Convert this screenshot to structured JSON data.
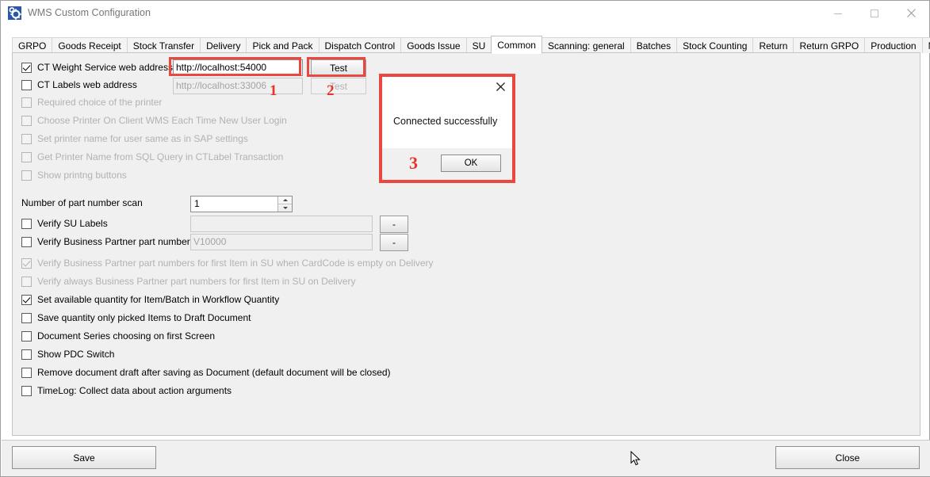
{
  "window": {
    "title": "WMS Custom Configuration",
    "icon": "gear-icon",
    "minimize_label": "–",
    "maximize_label": "□",
    "close_label": "✕"
  },
  "tabs": [
    {
      "label": "GRPO",
      "active": false
    },
    {
      "label": "Goods Receipt",
      "active": false
    },
    {
      "label": "Stock Transfer",
      "active": false
    },
    {
      "label": "Delivery",
      "active": false
    },
    {
      "label": "Pick and Pack",
      "active": false
    },
    {
      "label": "Dispatch Control",
      "active": false
    },
    {
      "label": "Goods Issue",
      "active": false
    },
    {
      "label": "SU",
      "active": false
    },
    {
      "label": "Common",
      "active": true
    },
    {
      "label": "Scanning: general",
      "active": false
    },
    {
      "label": "Batches",
      "active": false
    },
    {
      "label": "Stock Counting",
      "active": false
    },
    {
      "label": "Return",
      "active": false
    },
    {
      "label": "Return GRPO",
      "active": false
    },
    {
      "label": "Production",
      "active": false
    },
    {
      "label": "Manager",
      "active": false
    }
  ],
  "form": {
    "weight_service": {
      "checkbox_label": "CT Weight Service web address",
      "checked": true,
      "value": "http://localhost:54000",
      "test_button": "Test"
    },
    "labels_service": {
      "checkbox_label": "CT Labels web address",
      "checked": false,
      "value": "http://localhost:33006",
      "test_button": "Test"
    },
    "printer_options": [
      {
        "label": "Required choice of the printer",
        "checked": false,
        "disabled": true
      },
      {
        "label": "Choose Printer On Client WMS Each Time New User Login",
        "checked": false,
        "disabled": true
      },
      {
        "label": "Set printer name for user same as in SAP settings",
        "checked": false,
        "disabled": true
      },
      {
        "label": "Get Printer Name from SQL Query in CTLabel Transaction",
        "checked": false,
        "disabled": true
      },
      {
        "label": "Show printng buttons",
        "checked": false,
        "disabled": true
      }
    ],
    "part_number_scan": {
      "label": "Number of part number scan",
      "value": "1"
    },
    "verify_su_labels": {
      "label": "Verify SU Labels",
      "checked": false,
      "value": "",
      "button": "-"
    },
    "verify_bp_part_numbers": {
      "label": "Verify Business Partner part numbers",
      "checked": false,
      "value": "V10000",
      "button": "-"
    },
    "verify_options": [
      {
        "label": "Verify Business Partner part numbers for first Item in SU when CardCode is empty on Delivery",
        "checked": true,
        "disabled": true
      },
      {
        "label": "Verify always Business Partner part numbers for first Item in SU on Delivery",
        "checked": false,
        "disabled": true
      }
    ],
    "general_options": [
      {
        "label": "Set available quantity for Item/Batch in Workflow Quantity",
        "checked": true,
        "disabled": false
      },
      {
        "label": "Save quantity only picked Items to Draft Document",
        "checked": false,
        "disabled": false
      },
      {
        "label": "Document Series choosing on first Screen",
        "checked": false,
        "disabled": false
      },
      {
        "label": "Show PDC Switch",
        "checked": false,
        "disabled": false
      },
      {
        "label": "Remove document draft after saving as Document (default document will be closed)",
        "checked": false,
        "disabled": false
      },
      {
        "label": "TimeLog: Collect data about action arguments",
        "checked": false,
        "disabled": false
      }
    ]
  },
  "footer": {
    "save_label": "Save",
    "close_label": "Close"
  },
  "dialog": {
    "message": "Connected successfully",
    "ok_label": "OK",
    "close_icon": "close-icon"
  },
  "annotations": {
    "step1": "1",
    "step2": "2",
    "step3": "3",
    "color": "#e8483f"
  }
}
